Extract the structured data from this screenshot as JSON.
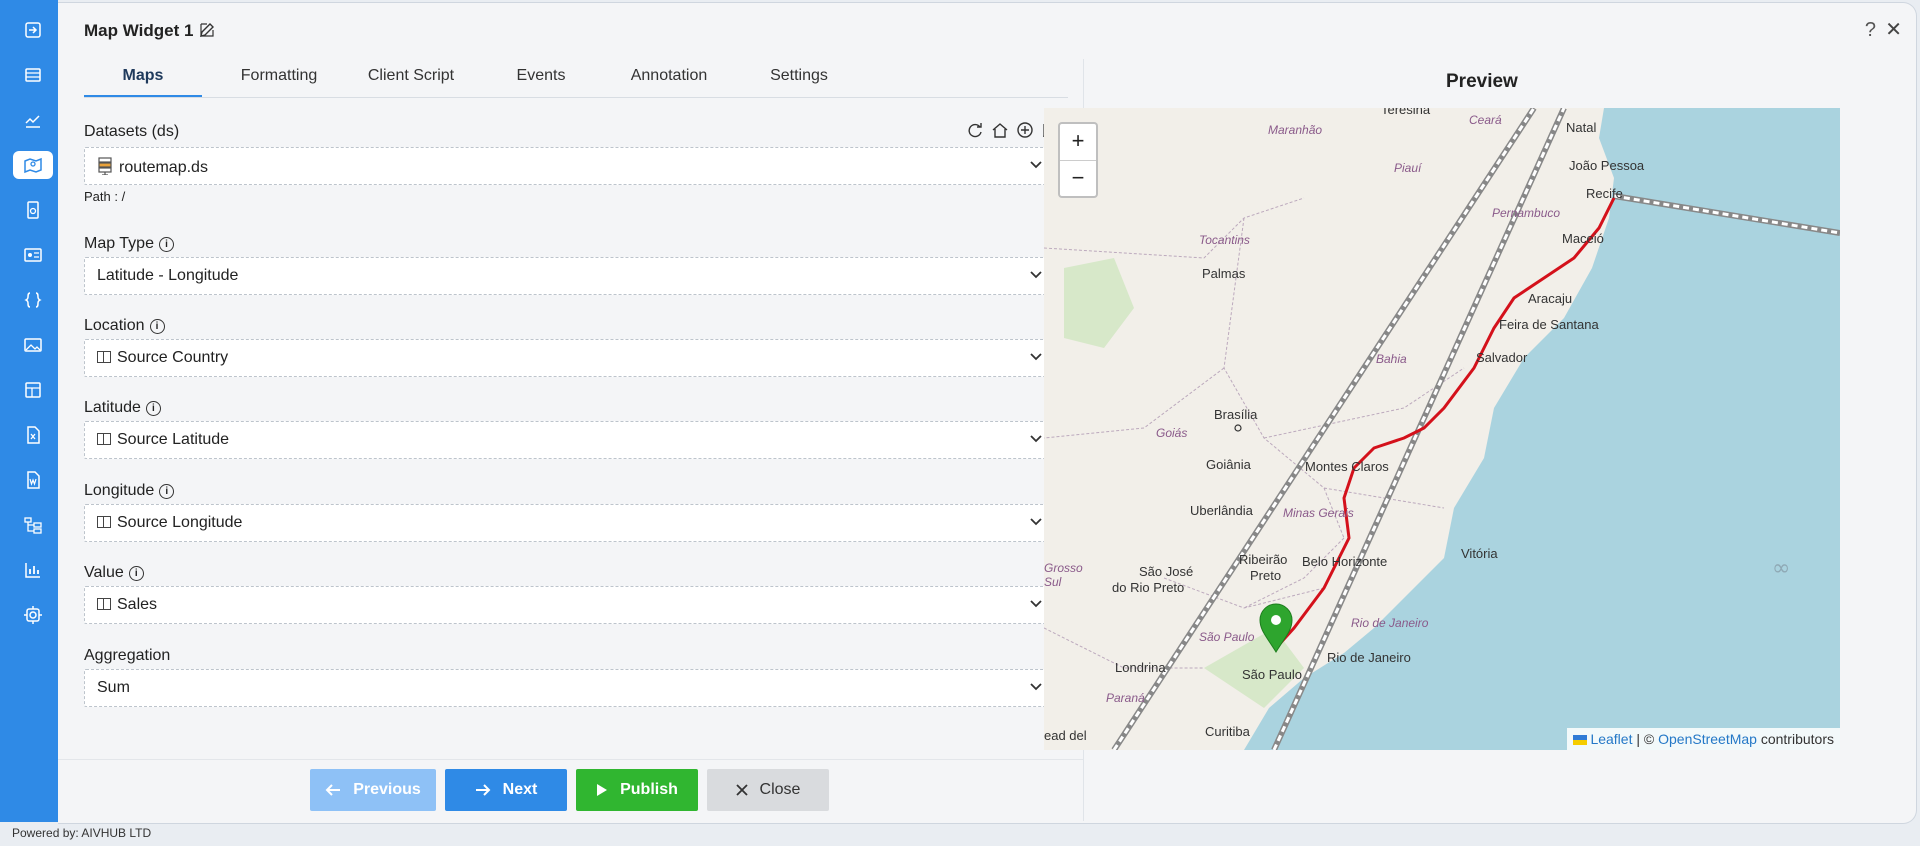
{
  "sidebar": {
    "icons": [
      "sign-in-icon",
      "table-icon",
      "line-chart-icon",
      "map-icon",
      "document-badge-icon",
      "contact-card-icon",
      "braces-icon",
      "image-icon",
      "layout-icon",
      "excel-file-icon",
      "word-file-icon",
      "tree-diagram-icon",
      "bar-chart-icon",
      "gear-icon"
    ],
    "active_index": 3
  },
  "dialog": {
    "title": "Map Widget 1",
    "help": "?",
    "close": "✕"
  },
  "tabs": [
    "Maps",
    "Formatting",
    "Client Script",
    "Events",
    "Annotation",
    "Settings"
  ],
  "fields": {
    "datasets_label": "Datasets (ds)",
    "datasets_value": "routemap.ds",
    "path": "Path : /",
    "map_type_label": "Map Type",
    "map_type_value": "Latitude - Longitude",
    "location_label": "Location",
    "location_value": "Source Country",
    "latitude_label": "Latitude",
    "latitude_value": "Source Latitude",
    "longitude_label": "Longitude",
    "longitude_value": "Source Longitude",
    "value_label": "Value",
    "value_value": "Sales",
    "aggregation_label": "Aggregation",
    "aggregation_value": "Sum"
  },
  "buttons": {
    "previous": "Previous",
    "next": "Next",
    "publish": "Publish",
    "close": "Close"
  },
  "preview": {
    "title": "Preview",
    "zoom_in": "+",
    "zoom_out": "−",
    "attrib_leaflet": "Leaflet",
    "attrib_sep": " | © ",
    "attrib_osm": "OpenStreetMap",
    "attrib_tail": " contributors",
    "labels": {
      "teresina": "Teresina",
      "ceara": "Ceará",
      "natal": "Natal",
      "maranhao": "Maranhão",
      "joao_pessoa": "João Pessoa",
      "piaui": "Piauí",
      "recife": "Recife",
      "pernambuco": "Pernambuco",
      "maceio": "Maceió",
      "tocantins": "Tocantins",
      "palmas": "Palmas",
      "aracaju": "Aracaju",
      "feira": "Feira de Santana",
      "bahia": "Bahia",
      "salvador": "Salvador",
      "brasilia": "Brasília",
      "goias": "Goiás",
      "goiania": "Goiânia",
      "montes_claros": "Montes Claros",
      "uberlandia": "Uberlândia",
      "minas": "Minas Gerais",
      "sao_jose": "São José",
      "rio_preto": "do Rio Preto",
      "ribeirao": "Ribeirão",
      "preto": "Preto",
      "bh": "Belo Horizonte",
      "vitoria": "Vitória",
      "grosso": "Grosso",
      "sul": "Sul",
      "sao_paulo_state": "São Paulo",
      "rj_state": "Rio de Janeiro",
      "londrina": "Londrina",
      "sao_paulo": "São Paulo",
      "rio": "Rio de Janeiro",
      "parana": "Paraná",
      "curitiba": "Curitiba",
      "cut": "ead del"
    }
  },
  "footer": "Powered by: AIVHUB LTD",
  "colors": {
    "brand": "#2f8ae6",
    "publish": "#30b630",
    "route": "#d4111b",
    "marker": "#2ea52e"
  }
}
